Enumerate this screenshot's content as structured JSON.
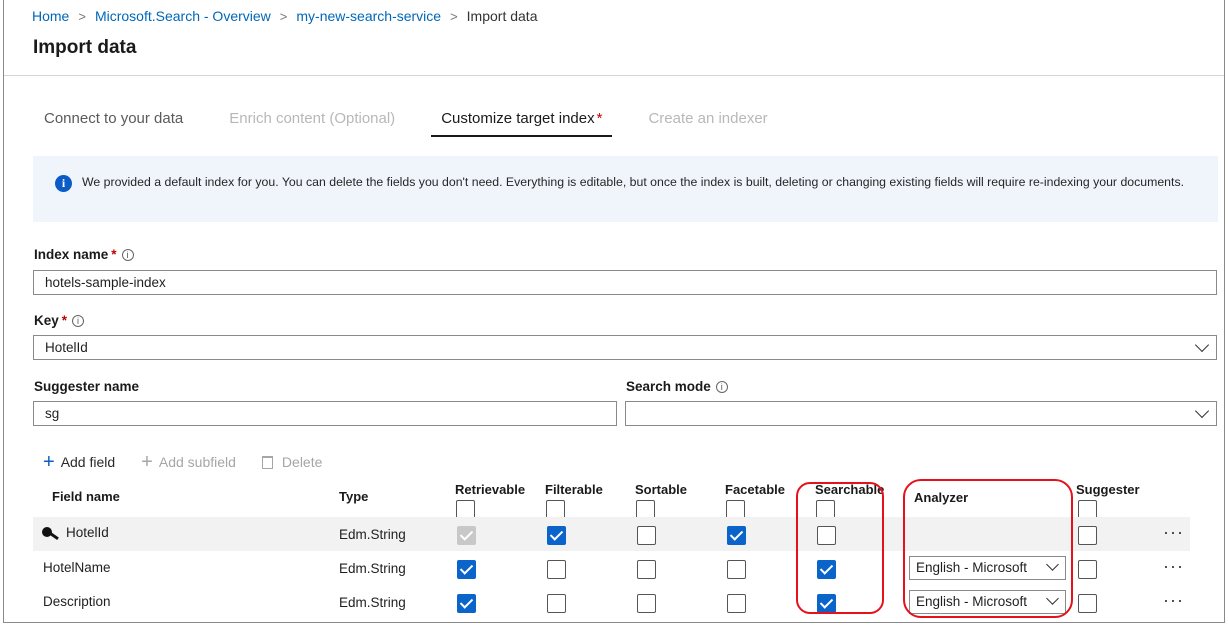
{
  "breadcrumb": {
    "items": [
      "Home",
      "Microsoft.Search - Overview",
      "my-new-search-service"
    ],
    "current": "Import data"
  },
  "page": {
    "title": "Import data"
  },
  "tabs": [
    {
      "label": "Connect to your data",
      "state": "normal"
    },
    {
      "label": "Enrich content (Optional)",
      "state": "disabled"
    },
    {
      "label": "Customize target index",
      "state": "active",
      "required": "*"
    },
    {
      "label": "Create an indexer",
      "state": "disabled"
    }
  ],
  "info_banner": {
    "text": "We provided a default index for you. You can delete the fields you don't need. Everything is editable, but once the index is built, deleting or changing existing fields will require re-indexing your documents."
  },
  "form": {
    "index_name": {
      "label": "Index name",
      "required": "*",
      "value": "hotels-sample-index"
    },
    "key": {
      "label": "Key",
      "required": "*",
      "value": "HotelId"
    },
    "suggester_name": {
      "label": "Suggester name",
      "value": "sg"
    },
    "search_mode": {
      "label": "Search mode",
      "value": ""
    }
  },
  "toolbar": {
    "add_field": "Add field",
    "add_subfield": "Add subfield",
    "delete": "Delete"
  },
  "table": {
    "headers": {
      "field_name": "Field name",
      "type": "Type",
      "retrievable": "Retrievable",
      "filterable": "Filterable",
      "sortable": "Sortable",
      "facetable": "Facetable",
      "searchable": "Searchable",
      "analyzer": "Analyzer",
      "suggester": "Suggester"
    },
    "rows": [
      {
        "name": "HotelId",
        "type": "Edm.String",
        "analyzer": "",
        "more": "···"
      },
      {
        "name": "HotelName",
        "type": "Edm.String",
        "analyzer": "English - Microsoft",
        "more": "···"
      },
      {
        "name": "Description",
        "type": "Edm.String",
        "analyzer": "English - Microsoft",
        "more": "···"
      }
    ],
    "checks": {
      "HotelId": {
        "retrievable": "checked-disabled",
        "filterable": true,
        "sortable": false,
        "facetable": true,
        "searchable": false,
        "suggester": false
      },
      "HotelName": {
        "retrievable": true,
        "filterable": false,
        "sortable": false,
        "facetable": false,
        "searchable": true,
        "suggester": false
      },
      "Description": {
        "retrievable": true,
        "filterable": false,
        "sortable": false,
        "facetable": false,
        "searchable": true,
        "suggester": false
      }
    }
  },
  "colors": {
    "link": "#0067b8",
    "checkbox_checked": "#0a64c9",
    "required": "#c00000",
    "annotation": "#e5121b",
    "banner_bg": "#f0f5fc"
  },
  "icons": [
    "info-icon",
    "hint-icon",
    "chevron-down-icon",
    "plus-icon",
    "trash-icon",
    "key-icon",
    "more-icon"
  ]
}
